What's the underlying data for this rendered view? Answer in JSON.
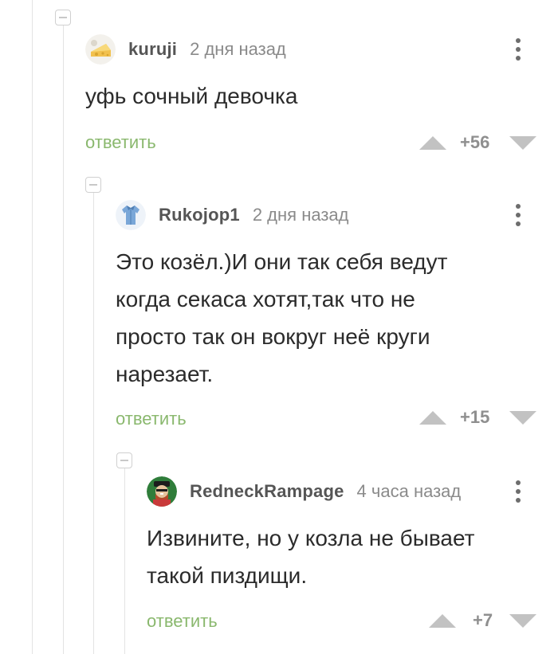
{
  "comments": [
    {
      "username": "kuruji",
      "time": "2 дня назад",
      "text": "уфь сочный девочка",
      "reply_label": "ответить",
      "rating": "+56",
      "avatar_icon": "cheese-avatar-icon"
    },
    {
      "username": "Rukojop1",
      "time": "2 дня назад",
      "text_lines": [
        "Это козёл.)И они так себя ведут",
        "когда секаса хотят,так что не",
        "просто так он вокруг неё круги",
        "нарезает."
      ],
      "reply_label": "ответить",
      "rating": "+15",
      "avatar_icon": "shirt-avatar-icon"
    },
    {
      "username": "RedneckRampage",
      "time": "4 часа назад",
      "text_lines": [
        "Извините, но у козла не бывает",
        "такой пиздищи."
      ],
      "reply_label": "ответить",
      "rating": "+7",
      "avatar_icon": "redneck-avatar-icon"
    }
  ],
  "colors": {
    "reply_link": "#8ab86e",
    "vote_arrow": "#c2c2c2",
    "thread_line": "#e3e3e3"
  }
}
